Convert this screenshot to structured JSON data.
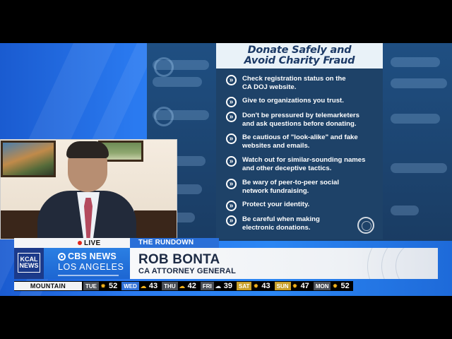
{
  "card": {
    "title_line1": "Donate Safely and",
    "title_line2": "Avoid Charity Fraud",
    "tips": [
      {
        "line1": "Check registration status on the",
        "line2": "CA DOJ website."
      },
      {
        "line1": "Give to organizations you trust.",
        "line2": ""
      },
      {
        "line1": "Don't be pressured by telemarketers",
        "line2": "and ask questions before donating."
      },
      {
        "line1": "Be cautious of \"look-alike\" and fake",
        "line2": "websites and emails."
      },
      {
        "line1": "Watch out for similar-sounding names",
        "line2": "and other deceptive tactics."
      },
      {
        "line1": "Be wary of peer-to-peer social",
        "line2": "network fundraising."
      },
      {
        "line1": "Protect your identity.",
        "line2": ""
      },
      {
        "line1": "Be careful when making",
        "line2": "electronic donations."
      }
    ]
  },
  "lower_third": {
    "live": "LIVE",
    "segment": "THE RUNDOWN",
    "station_line1": "KCAL",
    "station_line2": "NEWS",
    "network": "CBS NEWS",
    "city": "LOS ANGELES",
    "name": "ROB BONTA",
    "title": "CA ATTORNEY GENERAL"
  },
  "weather": {
    "location": "MOUNTAIN",
    "days": [
      {
        "day": "TUE",
        "icon": "sun-icon",
        "temp": "52"
      },
      {
        "day": "WED",
        "icon": "sun-cloud-icon",
        "temp": "43"
      },
      {
        "day": "THU",
        "icon": "sun-cloud-icon",
        "temp": "42"
      },
      {
        "day": "FRI",
        "icon": "cloud-icon",
        "temp": "39"
      },
      {
        "day": "SAT",
        "icon": "sun-icon",
        "temp": "43"
      },
      {
        "day": "SUN",
        "icon": "sun-icon",
        "temp": "47"
      },
      {
        "day": "MON",
        "icon": "sun-icon",
        "temp": "52"
      }
    ],
    "day_colors": [
      "#4a4f57",
      "#2f6fd6",
      "#4a4f57",
      "#4a4f57",
      "#c8a02a",
      "#c8a02a",
      "#4a4f57"
    ]
  }
}
